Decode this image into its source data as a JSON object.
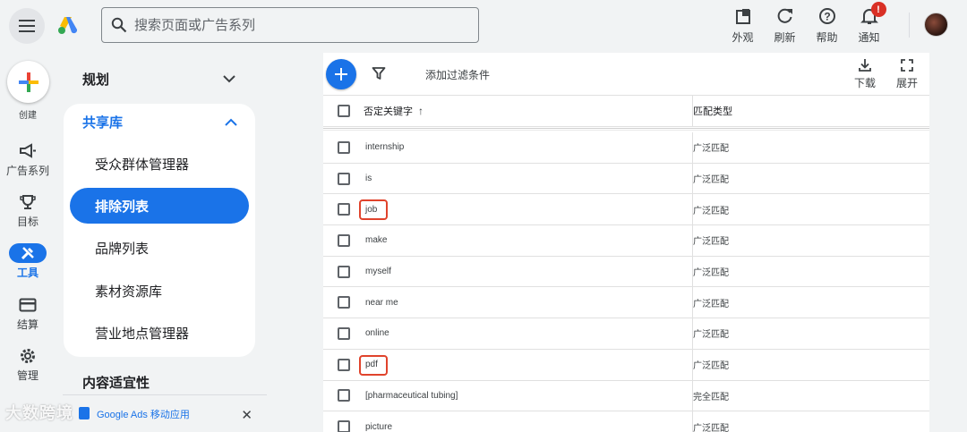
{
  "search": {
    "placeholder": "搜索页面或广告系列"
  },
  "top_actions": [
    {
      "icon": "appearance-icon",
      "label": "外观"
    },
    {
      "icon": "refresh-icon",
      "label": "刷新"
    },
    {
      "icon": "help-icon",
      "label": "帮助"
    },
    {
      "icon": "bell-icon",
      "label": "通知",
      "badge": "!"
    }
  ],
  "rail": {
    "create_label": "创建",
    "items": [
      {
        "icon": "megaphone-icon",
        "label": "广告系列"
      },
      {
        "icon": "trophy-icon",
        "label": "目标"
      },
      {
        "icon": "tools-icon",
        "label": "工具",
        "active": true
      },
      {
        "icon": "billing-card-icon",
        "label": "结算"
      },
      {
        "icon": "gear-icon",
        "label": "管理"
      }
    ]
  },
  "nav": {
    "planning": "规划",
    "shared_library": "共享库",
    "sub_items": [
      "受众群体管理器",
      "排除列表",
      "品牌列表",
      "素材资源库",
      "营业地点管理器"
    ],
    "active_index": 1,
    "content_suitability": "内容适宜性",
    "app_promo": "Google Ads 移动应用"
  },
  "toolbar": {
    "add_filter": "添加过滤条件",
    "download": "下载",
    "expand": "展开"
  },
  "table": {
    "col_keyword": "否定关键字",
    "col_match": "匹配类型",
    "rows": [
      {
        "keyword": "internship",
        "match": "广泛匹配"
      },
      {
        "keyword": "is",
        "match": "广泛匹配"
      },
      {
        "keyword": "job",
        "match": "广泛匹配",
        "highlighted": true
      },
      {
        "keyword": "make",
        "match": "广泛匹配"
      },
      {
        "keyword": "myself",
        "match": "广泛匹配"
      },
      {
        "keyword": "near me",
        "match": "广泛匹配"
      },
      {
        "keyword": "online",
        "match": "广泛匹配"
      },
      {
        "keyword": "pdf",
        "match": "广泛匹配",
        "highlighted": true
      },
      {
        "keyword": "[pharmaceutical tubing]",
        "match": "完全匹配"
      },
      {
        "keyword": "picture",
        "match": "广泛匹配"
      }
    ]
  },
  "watermark": "大数跨境",
  "colors": {
    "accent": "#1a73e8",
    "highlight": "#e0432c",
    "badge": "#d93025"
  }
}
